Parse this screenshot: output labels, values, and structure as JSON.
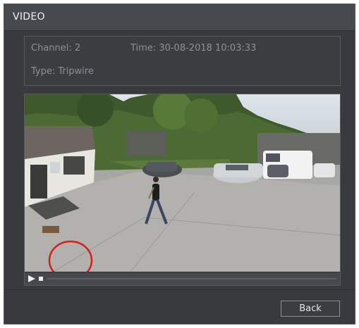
{
  "window": {
    "title": "VIDEO"
  },
  "event_info": {
    "channel": "Channel: 2",
    "time": "Time: 30-08-2018 10:03:33",
    "type": "Type: Tripwire"
  },
  "player": {
    "play_icon": "play-icon",
    "stop_icon": "stop-icon",
    "playback_progress": 0
  },
  "actions": {
    "back_label": "Back"
  },
  "colors": {
    "panel_bg": "#383a3e",
    "titlebar_bg": "#46494d",
    "text_muted": "#8e9095",
    "annotation_circle": "#d71e1e"
  }
}
